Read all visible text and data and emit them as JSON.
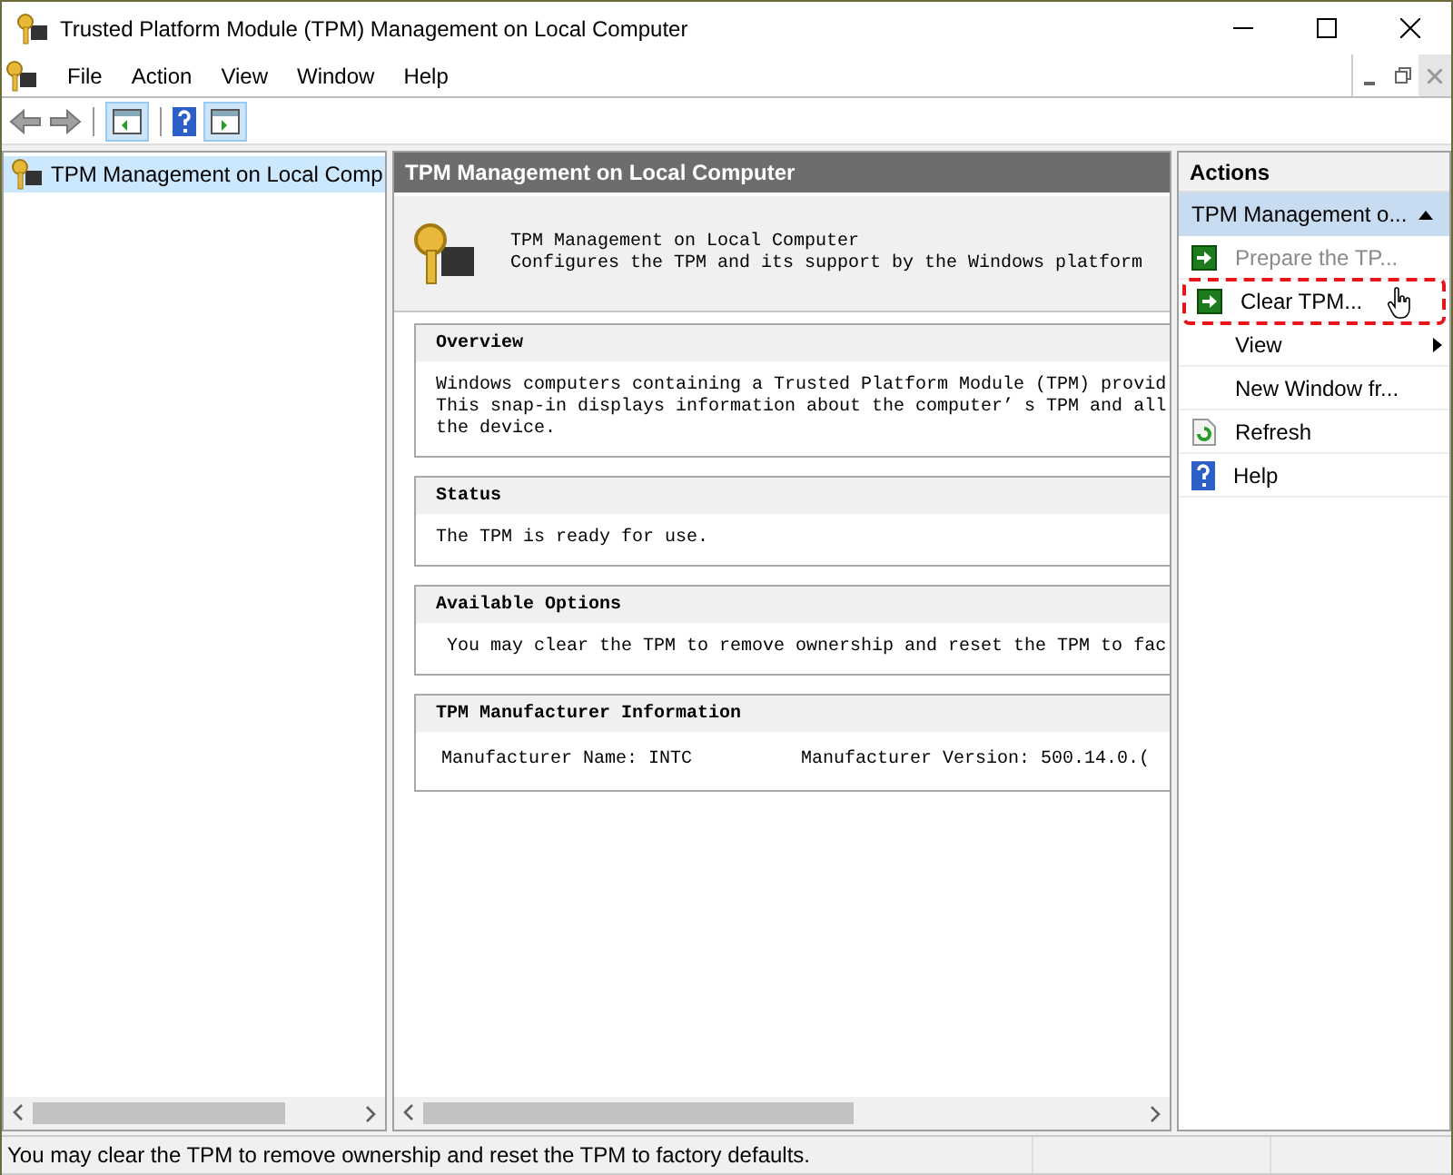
{
  "window": {
    "title": "Trusted Platform Module (TPM) Management on Local Computer"
  },
  "menu": [
    "File",
    "Action",
    "View",
    "Window",
    "Help"
  ],
  "tree": {
    "items": [
      {
        "label": "TPM Management on Local Comp",
        "selected": true
      }
    ]
  },
  "main": {
    "header": "TPM Management on Local Computer",
    "intro": [
      "TPM Management on Local Computer",
      "Configures the TPM and its support by the Windows platform"
    ],
    "sections": [
      {
        "title": "Overview",
        "kind": "text",
        "lines": [
          "Windows computers containing a Trusted Platform Module (TPM) provid",
          "This snap-in displays information about the computer’ s TPM and all",
          "the device."
        ]
      },
      {
        "title": "Status",
        "kind": "text",
        "lines": [
          "The TPM is ready for use."
        ]
      },
      {
        "title": "Available Options",
        "kind": "text",
        "lines": [
          " You may clear the TPM to remove ownership and reset the TPM to fac"
        ]
      },
      {
        "title": "TPM Manufacturer Information",
        "kind": "pairs",
        "pairs": [
          "Manufacturer Name: INTC",
          "Manufacturer Version: 500.14.0.("
        ]
      }
    ]
  },
  "actions": {
    "title": "Actions",
    "group": "TPM Management o...",
    "items": [
      {
        "label": "Prepare the TP...",
        "kind": "run",
        "disabled": true,
        "highlighted": false,
        "submenu": false
      },
      {
        "label": "Clear TPM...",
        "kind": "run",
        "disabled": false,
        "highlighted": true,
        "submenu": false
      },
      {
        "label": "View",
        "kind": "plain",
        "disabled": false,
        "highlighted": false,
        "submenu": true
      },
      {
        "label": "New Window fr...",
        "kind": "plain",
        "disabled": false,
        "highlighted": false,
        "submenu": false
      },
      {
        "label": "Refresh",
        "kind": "refresh",
        "disabled": false,
        "highlighted": false,
        "submenu": false
      },
      {
        "label": "Help",
        "kind": "help",
        "disabled": false,
        "highlighted": false,
        "submenu": false
      }
    ]
  },
  "status_bar": "You may clear the TPM to remove ownership and reset the TPM to factory defaults."
}
